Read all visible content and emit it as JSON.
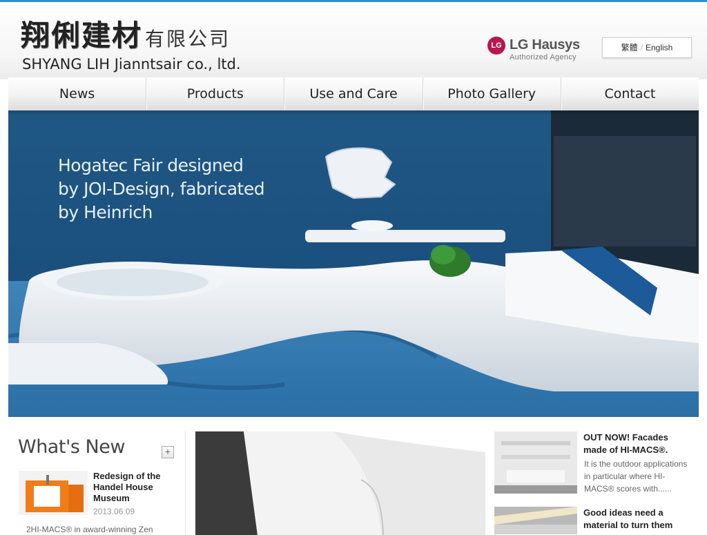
{
  "header": {
    "logo_cn_main": "翔俐建材",
    "logo_cn_sub": "有限公司",
    "logo_en": "SHYANG LIH Jianntsair co., ltd.",
    "partner_mark": "LG",
    "partner_name": "LG Hausys",
    "partner_sub": "Authorized Agency",
    "lang_traditional": "繁體",
    "lang_separator": "/",
    "lang_english": "English"
  },
  "nav": {
    "items": [
      "News",
      "Products",
      "Use and Care",
      "Photo Gallery",
      "Contact"
    ]
  },
  "hero": {
    "caption_line1": "Hogatec Fair designed",
    "caption_line2": "by JOI-Design, fabricated",
    "caption_line3": "by Heinrich"
  },
  "whats_new": {
    "title": "What's New",
    "more_label": "+",
    "item1": {
      "title": "Redesign of the Handel House Museum",
      "date": "2013.06.09",
      "excerpt": "2HI-MACS® in award-winning Zen"
    },
    "item2": {
      "title": "OUT NOW! Facades made of HI-MACS®.",
      "excerpt": "It is the outdoor applications in particular where HI-MACS® scores with......"
    },
    "item3": {
      "title": "Good ideas need a material to turn them"
    }
  },
  "colors": {
    "accent_line": "#2f8fd0",
    "lg_red": "#b5164d",
    "hero_blue": "#1a5486"
  }
}
